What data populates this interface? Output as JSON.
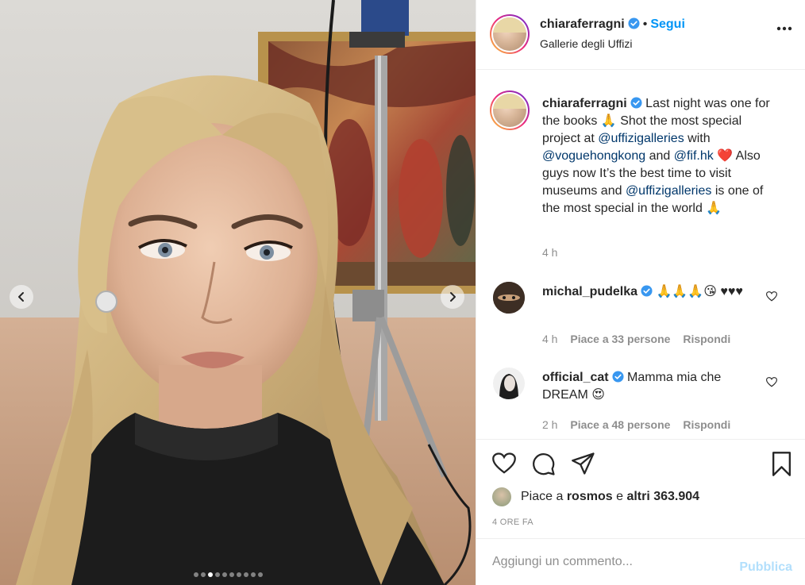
{
  "post": {
    "carousel": {
      "total_slides": 10,
      "active_index": 2
    }
  },
  "header": {
    "username": "chiaraferragni",
    "separator": "•",
    "follow_label": "Segui",
    "location": "Gallerie degli Uffizi"
  },
  "caption": {
    "username": "chiaraferragni",
    "parts": [
      {
        "text": "Last night was one for the books 🙏 Shot the most special project at ",
        "type": "text"
      },
      {
        "text": "@uffizigalleries",
        "type": "mention"
      },
      {
        "text": " with ",
        "type": "text"
      },
      {
        "text": "@voguehongkong",
        "type": "mention"
      },
      {
        "text": " and ",
        "type": "text"
      },
      {
        "text": "@fif.hk",
        "type": "mention"
      },
      {
        "text": " ❤️ Also guys now It’s the best time to visit museums and ",
        "type": "text"
      },
      {
        "text": "@uffizigalleries",
        "type": "mention"
      },
      {
        "text": " is one of the most special in the world 🙏",
        "type": "text"
      }
    ],
    "time": "4 h"
  },
  "comments": [
    {
      "username": "michal_pudelka",
      "verified": true,
      "text": "🙏🙏🙏😘 ♥♥♥",
      "time": "4 h",
      "likes": "Piace a 33 persone",
      "reply": "Rispondi"
    },
    {
      "username": "official_cat",
      "verified": true,
      "text": "Mamma mia che DREAM 😍",
      "time": "2 h",
      "likes": "Piace a 48 persone",
      "reply": "Rispondi"
    }
  ],
  "likes": {
    "prefix": "Piace a",
    "user": "rosmos",
    "middle": "e",
    "others": "altri 363.904"
  },
  "timestamp": "4 ORE FA",
  "add_comment": {
    "placeholder": "Aggiungi un commento...",
    "publish_label": "Pubblica"
  },
  "colors": {
    "accent": "#0095f6",
    "mention": "#00376b",
    "secondary_text": "#8e8e8e",
    "publish_disabled": "#b2dffc"
  },
  "icons": [
    "chevron-left-icon",
    "chevron-right-icon",
    "verified-badge-icon",
    "more-options-icon",
    "heart-icon",
    "comment-icon",
    "share-icon",
    "bookmark-icon"
  ]
}
